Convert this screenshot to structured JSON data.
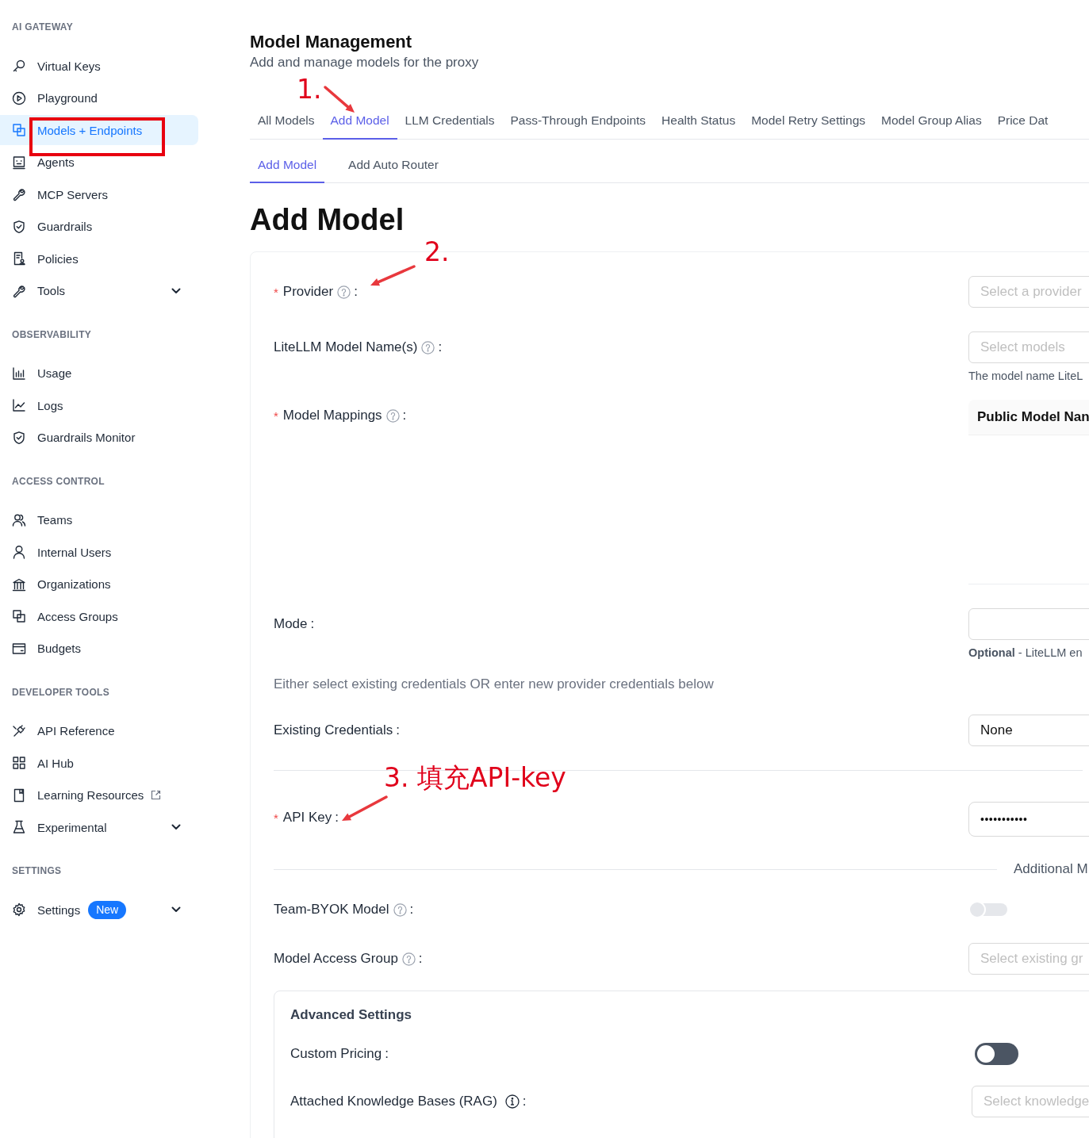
{
  "sidebar": {
    "sections": [
      {
        "heading": "AI GATEWAY",
        "items": [
          {
            "label": "Virtual Keys",
            "kind": "link",
            "selected": false
          },
          {
            "label": "Playground",
            "kind": "link",
            "selected": false
          },
          {
            "label": "Models + Endpoints",
            "kind": "link",
            "selected": true
          },
          {
            "label": "Agents",
            "kind": "link",
            "selected": false
          },
          {
            "label": "MCP Servers",
            "kind": "link",
            "selected": false
          },
          {
            "label": "Guardrails",
            "kind": "link",
            "selected": false
          },
          {
            "label": "Policies",
            "kind": "link",
            "selected": false
          },
          {
            "label": "Tools",
            "kind": "group",
            "selected": false
          }
        ]
      },
      {
        "heading": "OBSERVABILITY",
        "items": [
          {
            "label": "Usage",
            "kind": "link",
            "selected": false
          },
          {
            "label": "Logs",
            "kind": "link",
            "selected": false
          },
          {
            "label": "Guardrails Monitor",
            "kind": "link",
            "selected": false
          }
        ]
      },
      {
        "heading": "ACCESS CONTROL",
        "items": [
          {
            "label": "Teams",
            "kind": "link",
            "selected": false
          },
          {
            "label": "Internal Users",
            "kind": "link",
            "selected": false
          },
          {
            "label": "Organizations",
            "kind": "link",
            "selected": false
          },
          {
            "label": "Access Groups",
            "kind": "link",
            "selected": false
          },
          {
            "label": "Budgets",
            "kind": "link",
            "selected": false
          }
        ]
      },
      {
        "heading": "DEVELOPER TOOLS",
        "items": [
          {
            "label": "API Reference",
            "kind": "link",
            "selected": false
          },
          {
            "label": "AI Hub",
            "kind": "link",
            "selected": false
          },
          {
            "label": "Learning Resources",
            "kind": "external",
            "selected": false
          },
          {
            "label": "Experimental",
            "kind": "group",
            "selected": false
          }
        ]
      },
      {
        "heading": "SETTINGS",
        "items": [
          {
            "label": "Settings",
            "kind": "group",
            "selected": false,
            "badge": "New"
          }
        ]
      }
    ]
  },
  "header": {
    "title": "Model Management",
    "subtitle": "Add and manage models for the proxy"
  },
  "tabs": [
    {
      "label": "All Models",
      "selected": false
    },
    {
      "label": "Add Model",
      "selected": true
    },
    {
      "label": "LLM Credentials",
      "selected": false
    },
    {
      "label": "Pass-Through Endpoints",
      "selected": false
    },
    {
      "label": "Health Status",
      "selected": false
    },
    {
      "label": "Model Retry Settings",
      "selected": false
    },
    {
      "label": "Model Group Alias",
      "selected": false
    },
    {
      "label": "Price Dat",
      "selected": false
    }
  ],
  "subtabs": [
    {
      "label": "Add Model",
      "selected": true
    },
    {
      "label": "Add Auto Router",
      "selected": false
    }
  ],
  "page_title": "Add Model",
  "form": {
    "fields": [
      {
        "kind": "select",
        "marker": "*",
        "label": "Provider",
        "help": true,
        "suffix": ":",
        "placeholder": "Select a provider"
      },
      {
        "kind": "select",
        "label": "LiteLLM Model Name(s)",
        "help": true,
        "suffix": ":",
        "placeholder": "Select models",
        "hint": "The model name LiteL"
      },
      {
        "kind": "mappings",
        "marker": "*",
        "label": "Model Mappings",
        "help": true,
        "suffix": ":",
        "columns": [
          "Public Model Nan"
        ]
      },
      {
        "kind": "input",
        "label": "Mode",
        "suffix": ":",
        "hint": "**Optional** - LiteLLM en"
      },
      {
        "kind": "note",
        "text": "Either select existing credentials OR enter new provider credentials below"
      },
      {
        "kind": "select",
        "label": "Existing Credentials",
        "suffix": ":",
        "value": "None"
      },
      {
        "kind": "divider"
      },
      {
        "kind": "password",
        "marker": "*",
        "label": "API Key",
        "suffix": ":",
        "value": "•••••••••••"
      },
      {
        "kind": "divider",
        "text": "Additional M"
      },
      {
        "kind": "toggle",
        "label": "Team-BYOK Model",
        "help": true,
        "suffix": ":",
        "on": false,
        "disabled": true
      },
      {
        "kind": "select",
        "label": "Model Access Group",
        "help": true,
        "suffix": ":",
        "placeholder": "Select existing gr"
      }
    ]
  },
  "advanced": {
    "title": "Advanced Settings",
    "fields": [
      {
        "kind": "toggle",
        "label": "Custom Pricing",
        "suffix": ":",
        "on": false,
        "disabled": false
      },
      {
        "kind": "select",
        "label": "Attached Knowledge Bases (RAG)",
        "info": true,
        "suffix": ":",
        "placeholder": "Select knowledge"
      }
    ]
  },
  "annotations": [
    {
      "kind": "box"
    },
    {
      "kind": "arrow",
      "text": "1."
    },
    {
      "kind": "arrow",
      "text": "2."
    },
    {
      "kind": "arrow",
      "text": "3. 填充API-key"
    }
  ]
}
